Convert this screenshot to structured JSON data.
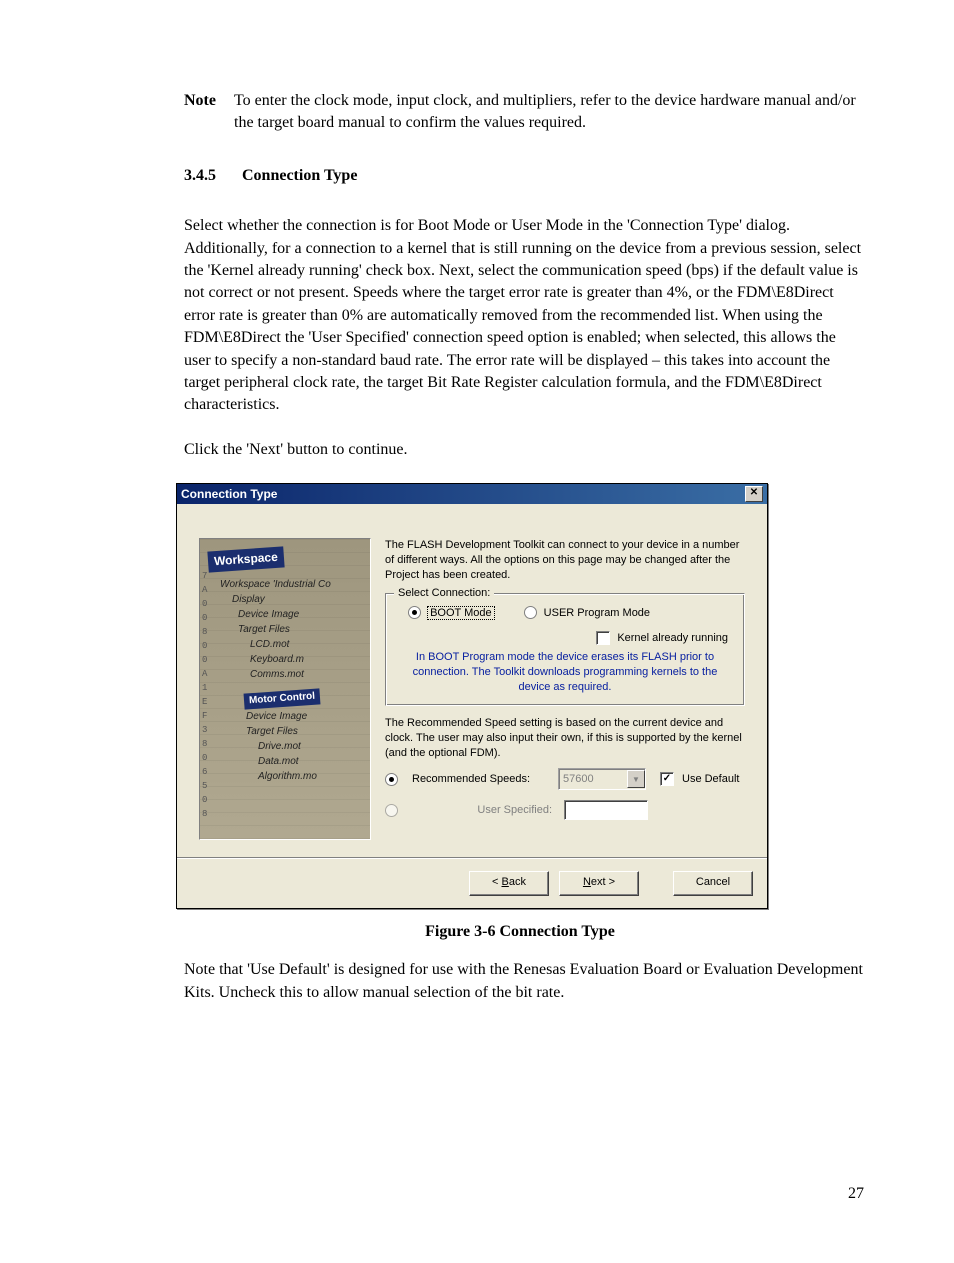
{
  "note": {
    "label": "Note",
    "text": "To enter the clock mode, input clock, and multipliers, refer to the device hardware manual and/or the target board manual to confirm the values required."
  },
  "section": {
    "number": "3.4.5",
    "title": "Connection Type"
  },
  "para1": "Select whether the connection is for Boot Mode or User Mode in the 'Connection Type' dialog. Additionally, for a connection to a kernel that is still running on the device from a previous session, select the 'Kernel already running' check box. Next, select the communication speed (bps) if the default value is not correct or not present. Speeds where the target error rate is greater than 4%, or the FDM\\E8Direct error rate is greater than 0% are automatically removed from the recommended list. When using the FDM\\E8Direct the 'User Specified' connection speed option is enabled; when selected, this allows the user to specify a non-standard baud rate. The error rate will be displayed – this takes into account the target peripheral clock rate, the target Bit Rate Register calculation formula, and the FDM\\E8Direct characteristics.",
  "para2": "Click the 'Next' button to continue.",
  "dialog": {
    "title": "Connection Type",
    "intro": "The FLASH Development Toolkit can connect to your device in a number of different ways. All the options on this page may be changed after the Project has been created.",
    "select_connection_legend": "Select Connection:",
    "boot_mode": "BOOT Mode",
    "user_prog_mode": "USER Program Mode",
    "kernel_running": "Kernel already running",
    "blue_note": "In BOOT Program mode the device erases its FLASH prior to connection. The Toolkit downloads programming kernels to the device as required.",
    "speed_text": "The Recommended Speed setting is based on the current device and clock. The user may also input their own, if this is supported by the kernel (and the optional FDM).",
    "recommended_label": "Recommended Speeds:",
    "recommended_value": "57600",
    "use_default": "Use Default",
    "user_specified": "User Specified:",
    "back": "Back",
    "next": "Next",
    "cancel": "Cancel",
    "tree": {
      "banner": "Workspace",
      "items1": [
        "Workspace 'Industrial Co",
        "Display",
        "Device Image",
        "Target Files",
        "LCD.mot",
        "Keyboard.m",
        "Comms.mot"
      ],
      "banner2": "Motor Control",
      "items2": [
        "Device Image",
        "Target Files",
        "Drive.mot",
        "Data.mot",
        "Algorithm.mo"
      ]
    }
  },
  "figure_caption": "Figure 3-6 Connection Type",
  "para3": "Note that 'Use Default' is designed for use with the Renesas Evaluation Board or Evaluation Development Kits. Uncheck this to allow manual selection of the bit rate.",
  "page_number": "27"
}
